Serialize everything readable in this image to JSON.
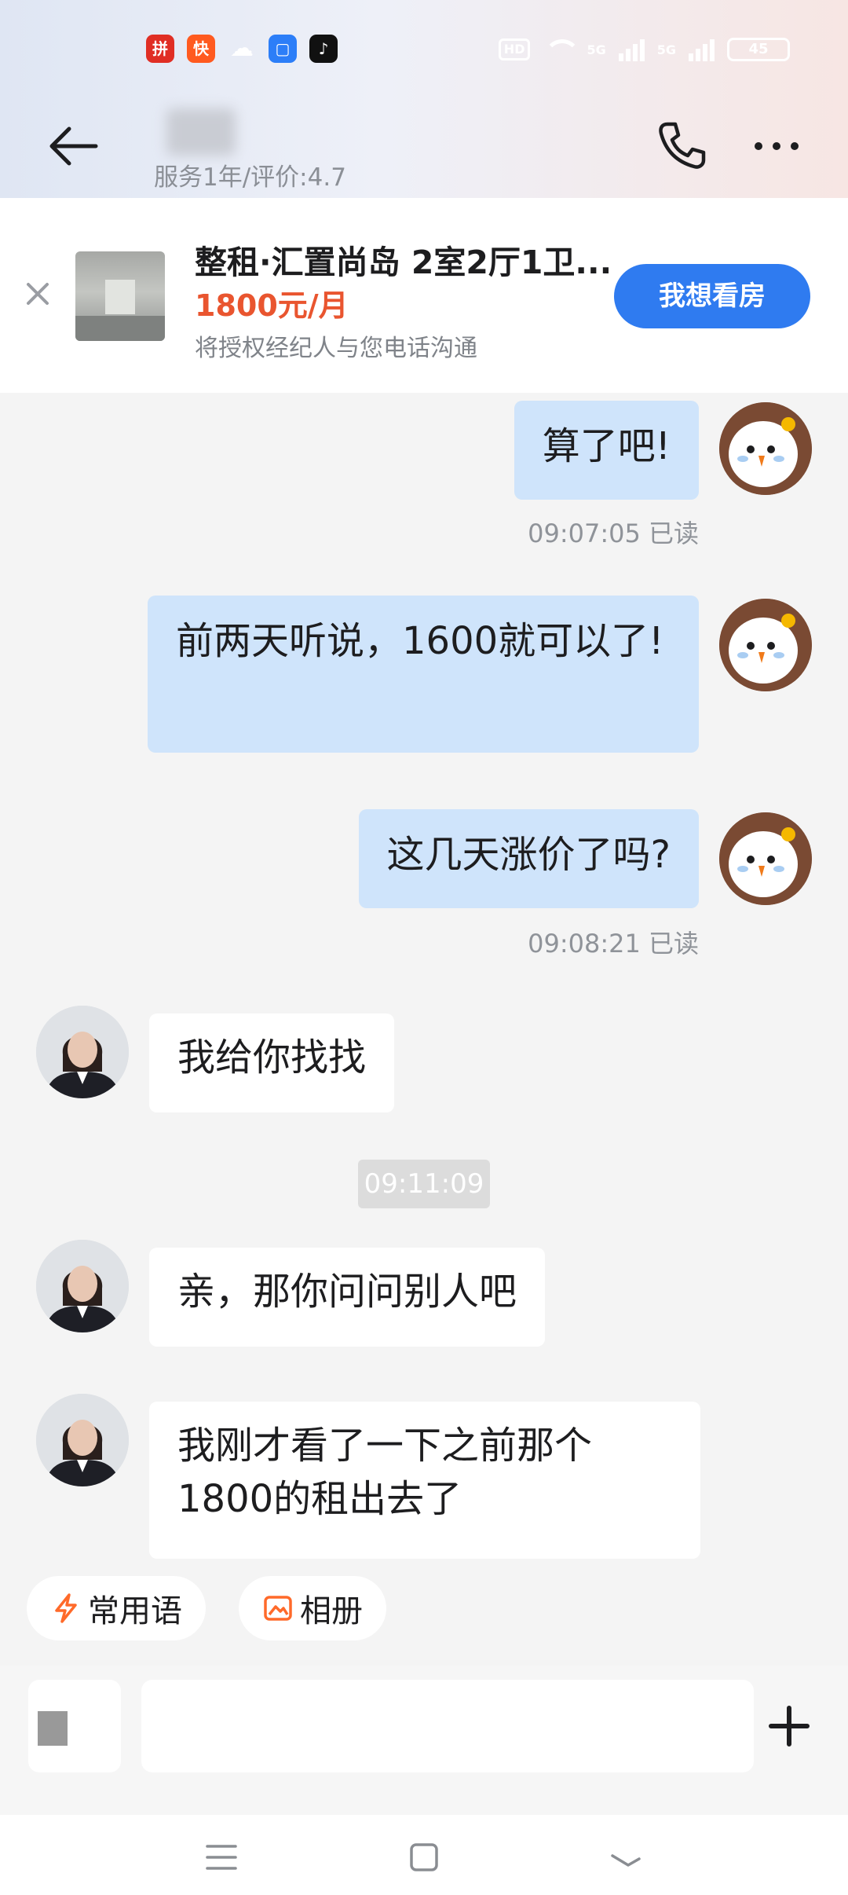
{
  "status_bar": {
    "apps": [
      {
        "name": "pinduoduo-icon",
        "color": "#e02e24",
        "glyph": "拼"
      },
      {
        "name": "kuaishou-icon",
        "color": "#ff5a1f",
        "glyph": "快"
      },
      {
        "name": "wechat-icon",
        "color": "#ffffff",
        "glyph": "☁"
      },
      {
        "name": "blue-app-icon",
        "color": "#2c7ef8",
        "glyph": "▢"
      },
      {
        "name": "tiktok-icon",
        "color": "#111111",
        "glyph": "♪"
      }
    ],
    "hd_label": "HD",
    "net_1": "5G",
    "net_2": "5G",
    "battery": "45"
  },
  "header": {
    "agent_name": "■■",
    "agent_subtitle": "服务1年/评价:4.7"
  },
  "listing": {
    "title": "整租·汇置尚岛 2室2厅1卫...",
    "price": "1800元/月",
    "note": "将授权经纪人与您电话沟通",
    "cta": "我想看房"
  },
  "messages": [
    {
      "side": "right",
      "text": "算了吧!",
      "read": "09:07:05 已读"
    },
    {
      "side": "right",
      "text": "前两天听说，1600就可以了!"
    },
    {
      "side": "right",
      "text": "这几天涨价了吗?",
      "read": "09:08:21 已读"
    },
    {
      "side": "left",
      "text": "我给你找找"
    },
    {
      "time": "09:11:09"
    },
    {
      "side": "left",
      "text": "亲，那你问问别人吧"
    },
    {
      "side": "left",
      "text": "我刚才看了一下之前那个1800的租出去了"
    }
  ],
  "quick_actions": [
    {
      "label": "常用语"
    },
    {
      "label": "相册"
    }
  ],
  "colors": {
    "accent": "#2f7bf0",
    "price": "#e9552f",
    "my_bubble": "#cfe4fb",
    "chip_icon": "#ff6a2a"
  }
}
